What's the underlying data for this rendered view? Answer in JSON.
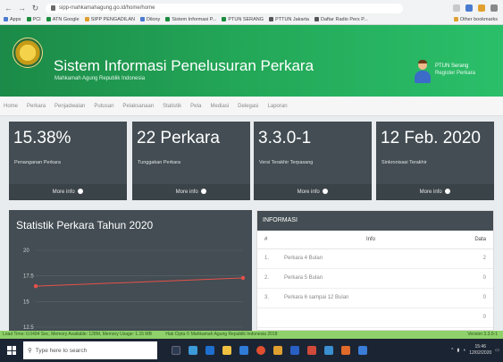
{
  "browser": {
    "url": "sipp-mahkamahagung.go.id/home/home",
    "bookmarks": [
      "Apps",
      "PCI",
      "ATN Google",
      "SIPP PENGADILAN",
      "Dilony",
      "Sistem Informasi P...",
      "PTUN SERANG",
      "PTTUN Jakarta",
      "Daftar Radio Pers P..."
    ],
    "bookmarks_right": "Other bookmarks"
  },
  "header": {
    "title": "Sistem Informasi Penelusuran Perkara",
    "subtitle": "Mahkamah Agung Republik Indonesia",
    "user_name": "PTUN Serang",
    "user_role": "Register Perkara"
  },
  "nav": [
    "Home",
    "Perkara",
    "Penjadwalan",
    "Putusan",
    "Pelaksanaan",
    "Statistik",
    "Peta",
    "Mediasi",
    "Delegasi",
    "Laporan"
  ],
  "cards": [
    {
      "value": "15.38%",
      "label": "Penanganan Perkara",
      "more": "More info"
    },
    {
      "value": "22 Perkara",
      "label": "Tunggakan Perkara",
      "more": "More info"
    },
    {
      "value": "3.3.0-1",
      "label": "Versi Terakhir Terpasang",
      "more": "More info"
    },
    {
      "value": "12 Feb. 2020",
      "label": "Sinkronisasi Terakhir",
      "more": "More info"
    }
  ],
  "statistik": {
    "title": "Statistik Perkara Tahun 2020"
  },
  "chart_data": {
    "type": "line",
    "title": "Statistik Perkara Tahun 2020",
    "y_ticks": [
      "20",
      "17.5",
      "15",
      "12.5"
    ],
    "ylim": [
      12.5,
      20
    ],
    "series": [
      {
        "values": [
          16.5,
          17.3
        ],
        "color": "#e8504a"
      }
    ],
    "grid": true
  },
  "info": {
    "title": "INFORMASI",
    "columns": [
      "#",
      "Info",
      "Data"
    ],
    "rows": [
      {
        "no": "1.",
        "info": "Perkara 4 Bulan",
        "data": "2"
      },
      {
        "no": "2.",
        "info": "Perkara 5 Bulan",
        "data": "0"
      },
      {
        "no": "3.",
        "info": "Perkara 6 sampai 12 Bulan",
        "data": "0"
      },
      {
        "no": "",
        "info": "",
        "data": "0"
      }
    ]
  },
  "status": {
    "left": "Load Time: 0.0494 Sec, Memory Available: 128M, Memory Usage: 1.15 MB",
    "center": "Hak Cipta © Mahkamah Agung Republik Indonesia 2018",
    "right": "Version 3.3.0-1"
  },
  "taskbar": {
    "search_placeholder": "Type here to search",
    "time": "15:46",
    "date": "12/02/2020"
  }
}
